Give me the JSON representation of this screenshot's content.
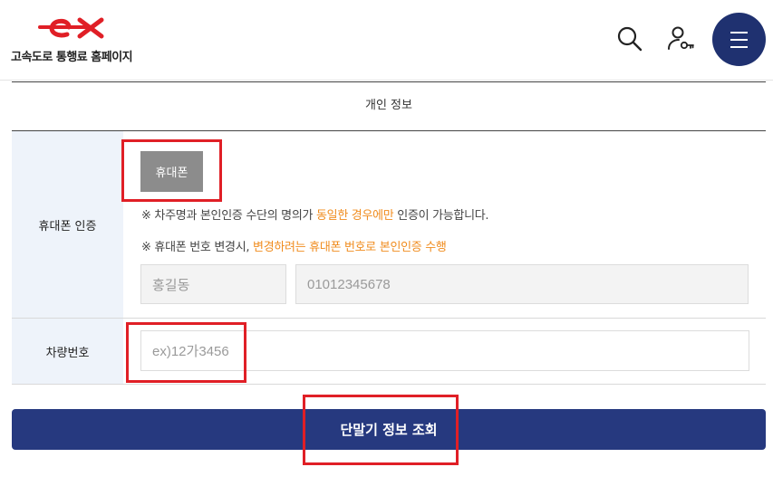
{
  "header": {
    "logo_text": "고속도로 통행료 홈페이지",
    "brand_color": "#e01f26",
    "icons": [
      "search-icon",
      "user-key-icon",
      "menu-icon"
    ]
  },
  "section": {
    "title": "개인 정보"
  },
  "phone_auth": {
    "label": "휴대폰 인증",
    "button_label": "휴대폰",
    "note1_prefix": "※ 차주명과 본인인증 수단의 명의가 ",
    "note1_highlight": "동일한 경우에만",
    "note1_suffix": " 인증이 가능합니다.",
    "note2_prefix": "※ 휴대폰 번호 변경시, ",
    "note2_highlight": "변경하려는 휴대폰 번호로 본인인증 수행",
    "name_value": "홍길동",
    "number_value": "01012345678"
  },
  "vehicle": {
    "label": "차량번호",
    "placeholder": "ex)12가3456"
  },
  "submit": {
    "label": "단말기 정보 조회"
  },
  "colors": {
    "primary": "#26397f",
    "menu_button": "#1f3170",
    "highlight_text": "#f08c1e",
    "annotation": "#e01f26",
    "label_bg": "#eef3fa"
  }
}
